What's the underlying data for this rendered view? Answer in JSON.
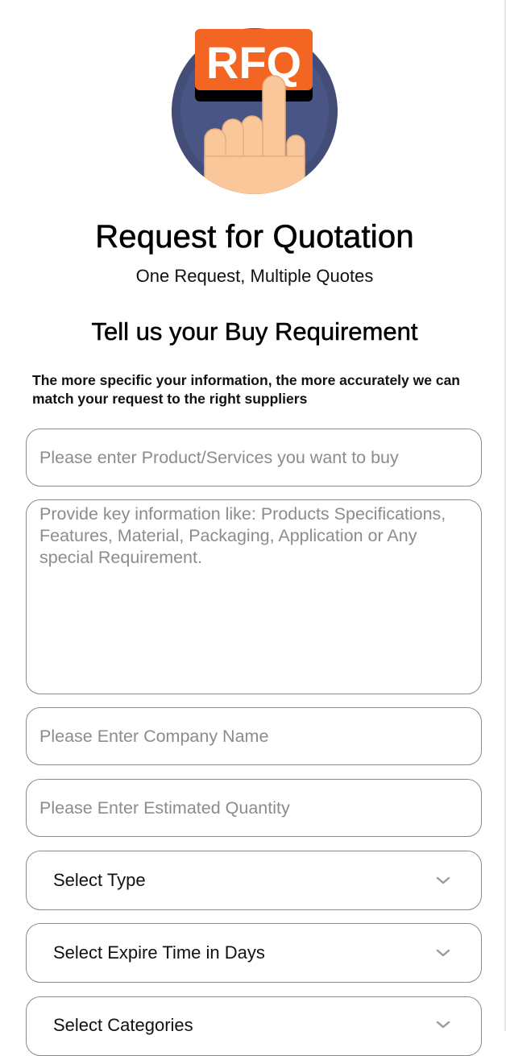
{
  "header": {
    "logo_text": "RFQ",
    "title": "Request for Quotation",
    "subtitle": "One Request, Multiple Quotes"
  },
  "form": {
    "heading": "Tell us your Buy Requirement",
    "description": "The more specific your information, the more accurately we can match your request to the right suppliers",
    "product_placeholder": "Please enter Product/Services you want to buy",
    "details_placeholder": "Provide key information like: Products Specifications, Features, Material, Packaging, Application or Any special Requirement.",
    "company_placeholder": "Please Enter Company Name",
    "quantity_placeholder": "Please Enter Estimated Quantity",
    "type_select": "Select Type",
    "expire_select": "Select Expire Time in Days",
    "categories_select": "Select Categories"
  },
  "colors": {
    "accent_orange": "#F26522",
    "circle_blue": "#4a5a8c",
    "border_gray": "#8a8a8a"
  },
  "icons": {
    "dropdown": "chevron-down-icon"
  }
}
